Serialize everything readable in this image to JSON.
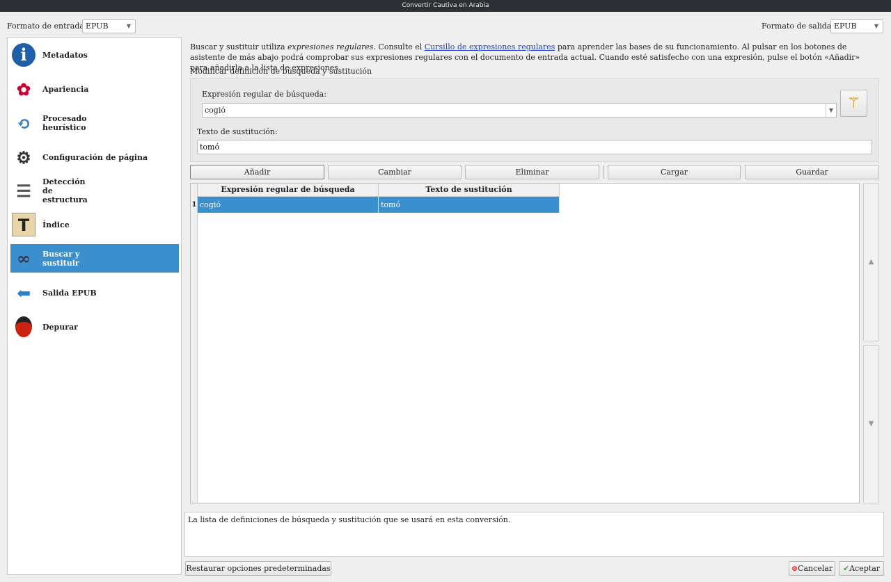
{
  "window": {
    "title": "Convertir Cautiva en Arabia"
  },
  "input_format": {
    "label": "Formato de entrada:",
    "value": "EPUB"
  },
  "output_format": {
    "label": "Formato de salida:",
    "value": "EPUB"
  },
  "sidebar": {
    "items": [
      {
        "label": "Metadatos",
        "icon": "info-icon"
      },
      {
        "label": "Apariencia",
        "icon": "appearance-icon"
      },
      {
        "label": "Procesado heurístico",
        "icon": "heuristics-icon"
      },
      {
        "label": "Configuración de página",
        "icon": "gear-icon"
      },
      {
        "label": "Detección de estructura",
        "icon": "document-icon"
      },
      {
        "label": "Índice",
        "icon": "toc-icon"
      },
      {
        "label": "Buscar y sustituir",
        "icon": "binoculars-icon",
        "selected": true
      },
      {
        "label": "Salida EPUB",
        "icon": "arrow-left-icon"
      },
      {
        "label": "Depurar",
        "icon": "ladybug-icon"
      }
    ]
  },
  "description": {
    "part1": "Buscar y sustituir utiliza ",
    "italic": "expresiones regulares",
    "part2": ". Consulte el ",
    "link": "Cursillo de expresiones regulares",
    "part3": " para aprender las bases de su funcionamiento. Al pulsar en los botones de asistente de más abajo podrá comprobar sus expresiones regulares con el documento de entrada actual. Cuando esté satisfecho con una expresión, pulse el botón «Añadir» para añadirla a la lista de expresiones."
  },
  "edit_section": {
    "title": "Modificar definición de búsqueda y sustitución",
    "search_label": "Expresión regular de búsqueda:",
    "search_value": "cogió",
    "replace_label": "Texto de sustitución:",
    "replace_value": "tomó"
  },
  "buttons": {
    "add": "Añadir",
    "change": "Cambiar",
    "remove": "Eliminar",
    "load": "Cargar",
    "save": "Guardar"
  },
  "table": {
    "headers": [
      "Expresión regular de búsqueda",
      "Texto de sustitución"
    ],
    "rows": [
      {
        "num": "1",
        "search": "cogió",
        "replace": "tomó"
      }
    ]
  },
  "help_text": "La lista de definiciones de búsqueda y sustitución que se usará en esta conversión.",
  "footer": {
    "restore": "Restaurar opciones predeterminadas",
    "cancel": "Cancelar",
    "ok": "Aceptar"
  }
}
